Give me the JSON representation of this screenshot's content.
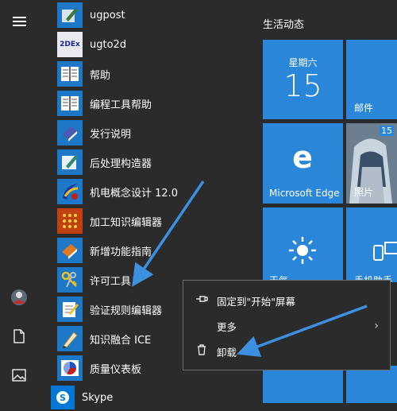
{
  "app_list": {
    "items": [
      {
        "label": "ugpost",
        "icon": "ugpost-icon"
      },
      {
        "label": "ugto2d",
        "icon": "ugto2d-icon",
        "icon_text": "2DEx"
      },
      {
        "label": "帮助",
        "icon": "help-book-icon"
      },
      {
        "label": "编程工具帮助",
        "icon": "programming-help-book-icon"
      },
      {
        "label": "发行说明",
        "icon": "release-notes-icon"
      },
      {
        "label": "后处理构造器",
        "icon": "postprocessor-builder-icon"
      },
      {
        "label": "机电概念设计 12.0",
        "icon": "mechatronics-icon"
      },
      {
        "label": "加工知识编辑器",
        "icon": "machining-knowledge-icon"
      },
      {
        "label": "新增功能指南",
        "icon": "whats-new-icon"
      },
      {
        "label": "许可工具",
        "icon": "license-tools-icon"
      },
      {
        "label": "验证规则编辑器",
        "icon": "validation-rules-icon"
      },
      {
        "label": "知识融合 ICE",
        "icon": "knowledge-fusion-icon"
      },
      {
        "label": "质量仪表板",
        "icon": "quality-dashboard-icon"
      },
      {
        "label": "Skype",
        "icon": "skype-icon"
      }
    ]
  },
  "tiles": {
    "section_title": "生活动态",
    "calendar": {
      "weekday": "星期六",
      "day": "15"
    },
    "mail_label": "邮件",
    "edge_label": "Microsoft Edge",
    "photos_label": "照片",
    "photos_badge": "15",
    "weather_label": "天气",
    "phone_label": "手机助手"
  },
  "context_menu": {
    "pin_label": "固定到\"开始\"屏幕",
    "more_label": "更多",
    "uninstall_label": "卸载"
  },
  "colors": {
    "tile_blue": "#2a86d8",
    "background": "#2b2b2b",
    "arrow": "#3d8fe0"
  }
}
